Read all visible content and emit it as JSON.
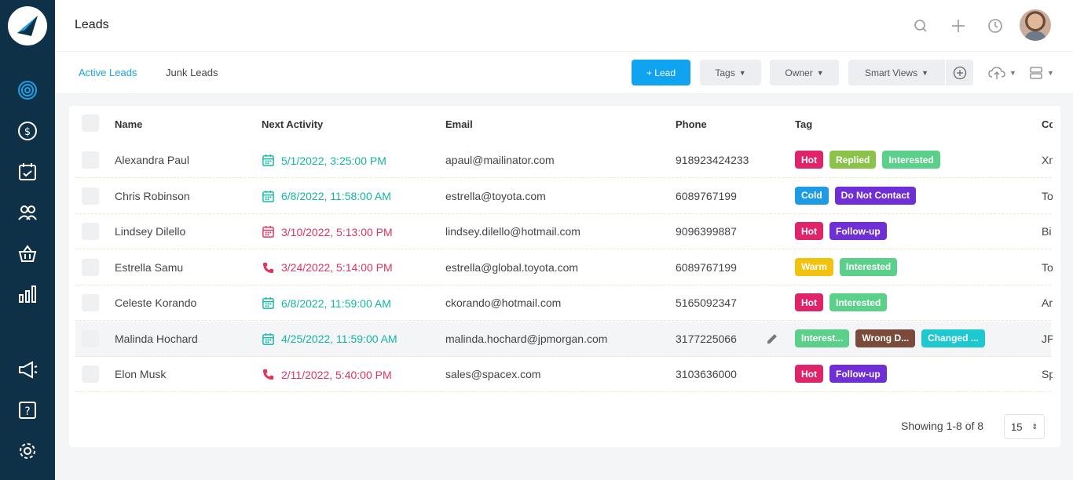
{
  "app": {
    "page_title": "Leads"
  },
  "colors": {
    "sidebar": "#0f3147",
    "accent": "#10a3f0",
    "teal": "#12b5a6",
    "red": "#e0335e"
  },
  "sidebar": {
    "icons": [
      "target-icon",
      "dollar-icon",
      "calendar-check-icon",
      "users-icon",
      "basket-icon",
      "bar-chart-icon",
      "megaphone-icon",
      "help-icon",
      "settings-icon"
    ]
  },
  "header": {
    "icons": [
      "search-icon",
      "plus-icon",
      "history-icon"
    ]
  },
  "toolbar": {
    "tabs": [
      {
        "label": "Active Leads"
      },
      {
        "label": "Junk Leads"
      }
    ],
    "add_lead": "+ Lead",
    "tags": "Tags",
    "owner": "Owner",
    "smart_views": "Smart Views"
  },
  "table": {
    "columns": [
      "Name",
      "Next Activity",
      "Email",
      "Phone",
      "Tag",
      "Co"
    ],
    "rows": [
      {
        "name": "Alexandra Paul",
        "activity": "5/1/2022, 3:25:00 PM",
        "activity_icon": "calendar-icon",
        "activity_color": "teal",
        "email": "apaul@mailinator.com",
        "phone": "918923424233",
        "company": "Xn",
        "tags": [
          {
            "label": "Hot",
            "color": "#e0246a"
          },
          {
            "label": "Replied",
            "color": "#8bc34a"
          },
          {
            "label": "Interested",
            "color": "#5bd08a"
          }
        ]
      },
      {
        "name": "Chris Robinson",
        "activity": "6/8/2022, 11:58:00 AM",
        "activity_icon": "calendar-icon",
        "activity_color": "teal",
        "email": "estrella@toyota.com",
        "phone": "6089767199",
        "company": "To",
        "tags": [
          {
            "label": "Cold",
            "color": "#1e9be6"
          },
          {
            "label": "Do Not Contact",
            "color": "#6f2ed6"
          }
        ]
      },
      {
        "name": "Lindsey Dilello",
        "activity": "3/10/2022, 5:13:00 PM",
        "activity_icon": "calendar-icon",
        "activity_color": "red",
        "email": "lindsey.dilello@hotmail.com",
        "phone": "9096399887",
        "company": "Bi",
        "tags": [
          {
            "label": "Hot",
            "color": "#e0246a"
          },
          {
            "label": "Follow-up",
            "color": "#6f2ed6"
          }
        ]
      },
      {
        "name": "Estrella Samu",
        "activity": "3/24/2022, 5:14:00 PM",
        "activity_icon": "phone-icon",
        "activity_color": "red",
        "email": "estrella@global.toyota.com",
        "phone": "6089767199",
        "company": "To",
        "tags": [
          {
            "label": "Warm",
            "color": "#f2c20f"
          },
          {
            "label": "Interested",
            "color": "#5bd08a"
          }
        ]
      },
      {
        "name": "Celeste Korando",
        "activity": "6/8/2022, 11:59:00 AM",
        "activity_icon": "calendar-icon",
        "activity_color": "teal",
        "email": "ckorando@hotmail.com",
        "phone": "5165092347",
        "company": "Ar",
        "tags": [
          {
            "label": "Hot",
            "color": "#e0246a"
          },
          {
            "label": "Interested",
            "color": "#5bd08a"
          }
        ]
      },
      {
        "name": "Malinda Hochard",
        "activity": "4/25/2022, 11:59:00 AM",
        "activity_icon": "calendar-icon",
        "activity_color": "teal",
        "email": "malinda.hochard@jpmorgan.com",
        "phone": "3177225066",
        "company": "JP",
        "highlight": true,
        "tags": [
          {
            "label": "Interest...",
            "color": "#5bd08a"
          },
          {
            "label": "Wrong D...",
            "color": "#7a4a3a"
          },
          {
            "label": "Changed ...",
            "color": "#1ec8d0"
          }
        ]
      },
      {
        "name": "Elon Musk",
        "activity": "2/11/2022, 5:40:00 PM",
        "activity_icon": "phone-icon",
        "activity_color": "red",
        "email": "sales@spacex.com",
        "phone": "3103636000",
        "company": "Sp",
        "tags": [
          {
            "label": "Hot",
            "color": "#e0246a"
          },
          {
            "label": "Follow-up",
            "color": "#6f2ed6"
          }
        ]
      }
    ]
  },
  "pagination": {
    "showing": "Showing 1-8 of 8",
    "per_page": "15"
  }
}
